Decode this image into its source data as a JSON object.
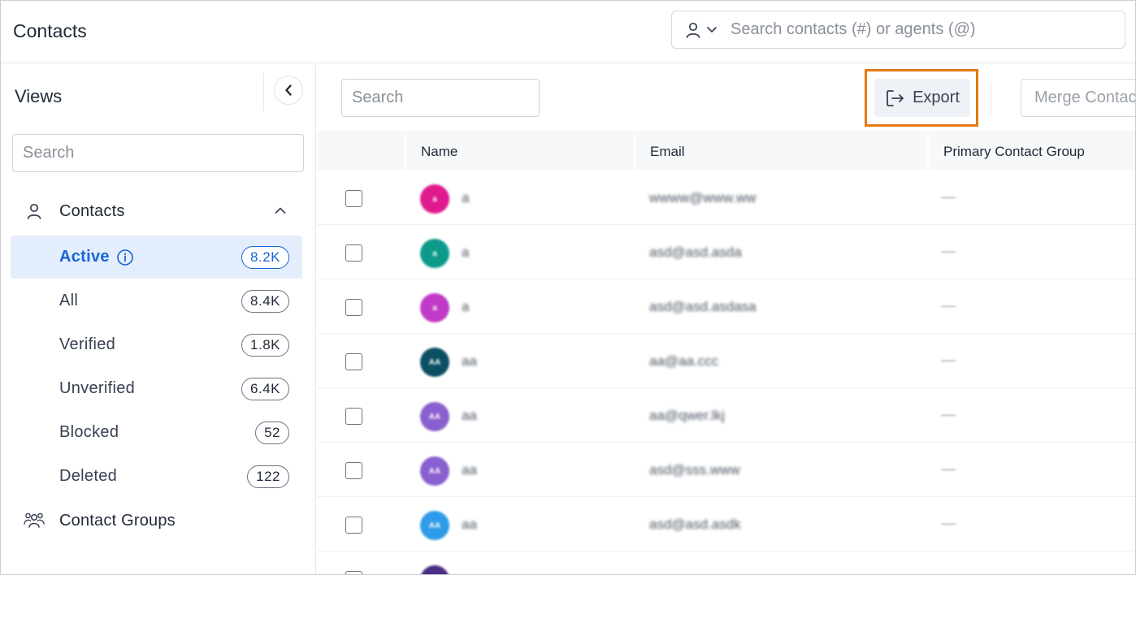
{
  "header": {
    "title": "Contacts",
    "search_placeholder": "Search contacts (#) or agents (@)"
  },
  "sidebar": {
    "title": "Views",
    "search_placeholder": "Search",
    "contacts_section": "Contacts",
    "groups_section": "Contact Groups",
    "views": [
      {
        "label": "Active",
        "count": "8.2K",
        "active": true
      },
      {
        "label": "All",
        "count": "8.4K"
      },
      {
        "label": "Verified",
        "count": "1.8K"
      },
      {
        "label": "Unverified",
        "count": "6.4K"
      },
      {
        "label": "Blocked",
        "count": "52"
      },
      {
        "label": "Deleted",
        "count": "122"
      }
    ]
  },
  "main": {
    "search_placeholder": "Search",
    "export_label": "Export",
    "merge_label": "Merge Contacts",
    "columns": [
      "Name",
      "Email",
      "Primary Contact Group"
    ],
    "rows": [
      {
        "initials": "a",
        "name": "a",
        "email": "wwww@www.ww",
        "group": "—",
        "color": "#e0198f"
      },
      {
        "initials": "a",
        "name": "a",
        "email": "asd@asd.asda",
        "group": "—",
        "color": "#0e9a8a"
      },
      {
        "initials": "a",
        "name": "a",
        "email": "asd@asd.asdasa",
        "group": "—",
        "color": "#c13ac7"
      },
      {
        "initials": "AA",
        "name": "aa",
        "email": "aa@aa.ccc",
        "group": "—",
        "color": "#0c4f63"
      },
      {
        "initials": "AA",
        "name": "aa",
        "email": "aa@qwer.lkj",
        "group": "—",
        "color": "#8a5fcf"
      },
      {
        "initials": "AA",
        "name": "aa",
        "email": "asd@sss.www",
        "group": "—",
        "color": "#8a5fcf"
      },
      {
        "initials": "AA",
        "name": "aa",
        "email": "asd@asd.asdk",
        "group": "—",
        "color": "#2e9be8"
      },
      {
        "initials": "",
        "name": "",
        "email": "",
        "group": "",
        "color": "#4c2e83"
      }
    ]
  }
}
